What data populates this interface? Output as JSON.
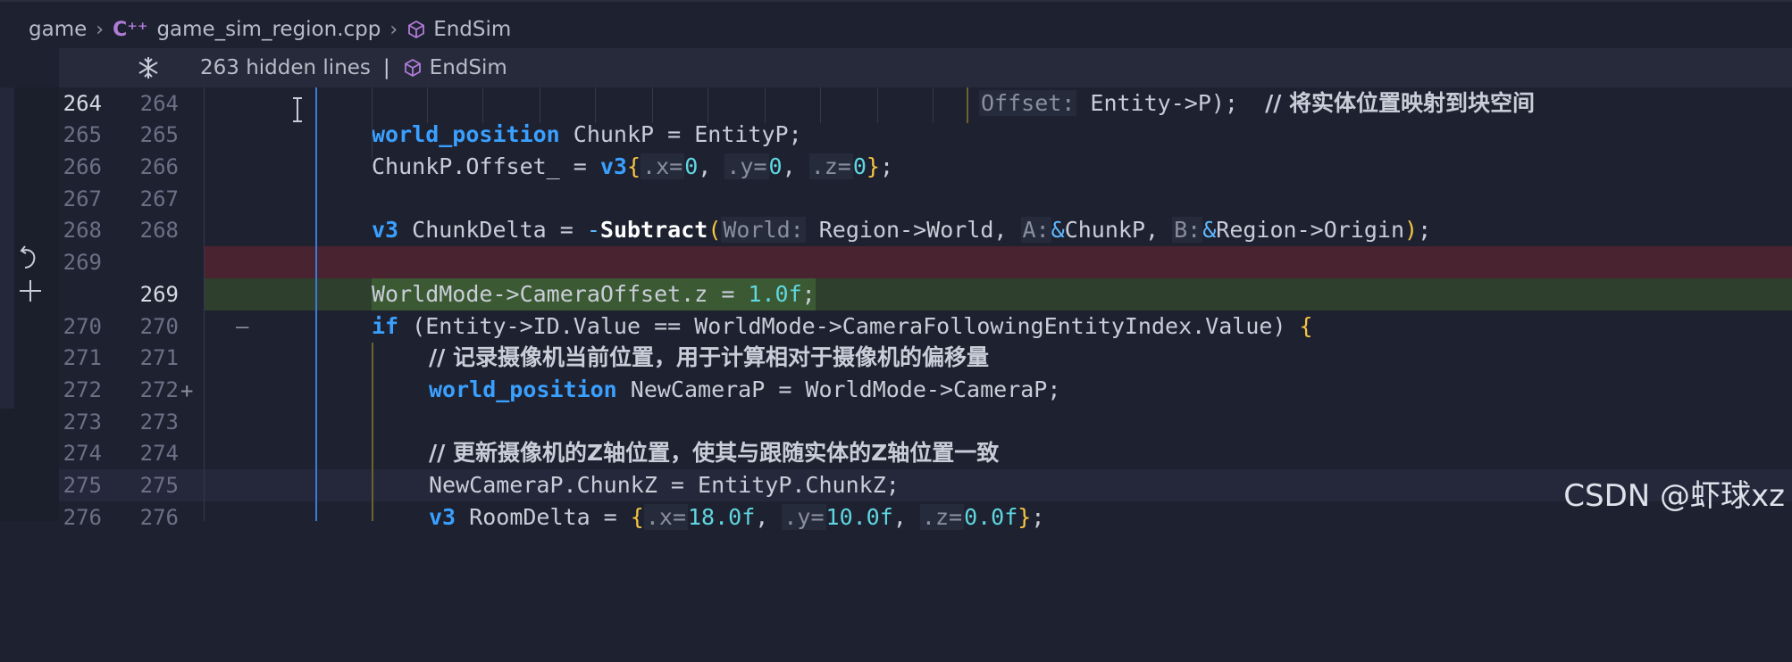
{
  "breadcrumb": {
    "root": "game",
    "file_badge": "C⁺⁺",
    "file": "game_sim_region.cpp",
    "symbol": "EndSim"
  },
  "sticky": {
    "hidden_lines": "263 hidden lines",
    "separator": "|",
    "symbol": "EndSim"
  },
  "lines": [
    {
      "old": "264",
      "new": "264"
    },
    {
      "old": "265",
      "new": "265"
    },
    {
      "old": "266",
      "new": "266"
    },
    {
      "old": "267",
      "new": "267"
    },
    {
      "old": "268",
      "new": "268"
    },
    {
      "old": "269",
      "new": ""
    },
    {
      "old": "",
      "new": "269"
    },
    {
      "old": "270",
      "new": "270"
    },
    {
      "old": "271",
      "new": "271"
    },
    {
      "old": "272",
      "new": "272"
    },
    {
      "old": "273",
      "new": "273"
    },
    {
      "old": "274",
      "new": "274"
    },
    {
      "old": "275",
      "new": "275"
    },
    {
      "old": "276",
      "new": "276"
    }
  ],
  "code": {
    "l264_hint": "Offset:",
    "l264_rest": " Entity->P);  ",
    "l264_comment": "// 将实体位置映射到块空间",
    "l265_type": "world_position",
    "l265_rest": " ChunkP = EntityP;",
    "l266_a": "ChunkP.Offset_ = ",
    "l266_type": "v3",
    "l266_x": ".x=",
    "l266_0a": "0",
    "l266_y": ".y=",
    "l266_0b": "0",
    "l266_z": ".z=",
    "l266_0c": "0",
    "l268_type": "v3",
    "l268_a": " ChunkDelta = ",
    "l268_fn": "Subtract",
    "l268_h1": "World:",
    "l268_a1": " Region->World, ",
    "l268_h2": "A:",
    "l268_a2": "ChunkP, ",
    "l268_h3": "B:",
    "l268_a3": "Region->Origin",
    "l269_a": "WorldMode->CameraOffset.z = ",
    "l269_num": "1.0f",
    "l270_kw": "if",
    "l270_a": " (Entity->ID.Value == WorldMode->CameraFollowingEntityIndex.Value) ",
    "l271_comment": "// 记录摄像机当前位置，用于计算相对于摄像机的偏移量",
    "l272_type": "world_position",
    "l272_rest": " NewCameraP = WorldMode->CameraP;",
    "l274_comment": "// 更新摄像机的Z轴位置，使其与跟随实体的Z轴位置一致",
    "l275": "NewCameraP.ChunkZ = EntityP.ChunkZ;",
    "l276_type": "v3",
    "l276_a": " RoomDelta = ",
    "l276_x": ".x=",
    "l276_n1": "18.0f",
    "l276_y": ".y=",
    "l276_n2": "10.0f",
    "l276_z": ".z=",
    "l276_n3": "0.0f"
  },
  "watermark": "CSDN @虾球xz"
}
